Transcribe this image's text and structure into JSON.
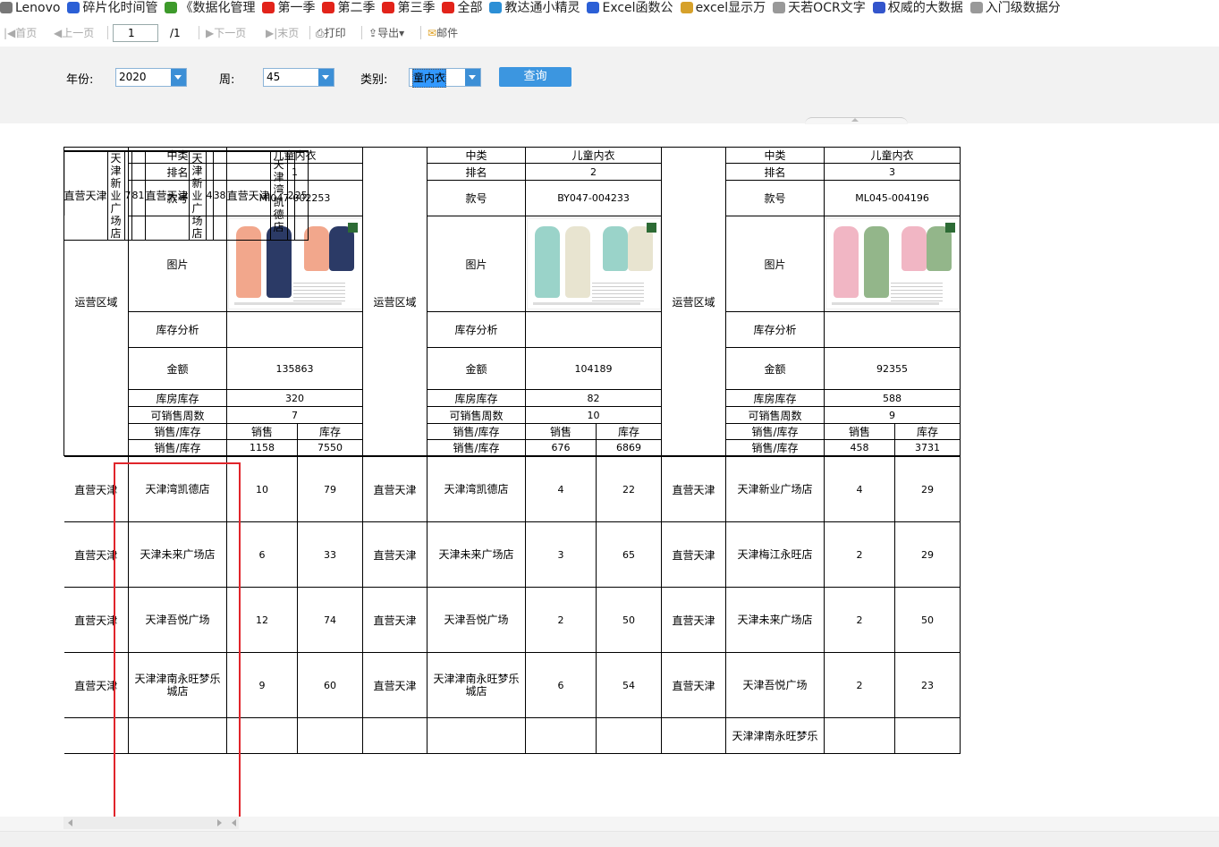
{
  "bookmarks": [
    {
      "label": "Lenovo",
      "icon": "folder-icon",
      "color": "#777777"
    },
    {
      "label": "碎片化时间管",
      "icon": "bookmark-icon",
      "color": "#2b5fd6"
    },
    {
      "label": "《数据化管理",
      "icon": "tree-icon",
      "color": "#3d9a2b"
    },
    {
      "label": "第一季",
      "icon": "weibo-icon",
      "color": "#e2231a"
    },
    {
      "label": "第二季",
      "icon": "weibo-icon",
      "color": "#e2231a"
    },
    {
      "label": "第三季",
      "icon": "weibo-icon",
      "color": "#e2231a"
    },
    {
      "label": "全部",
      "icon": "weibo-icon",
      "color": "#e2231a"
    },
    {
      "label": "教达通小精灵",
      "icon": "edit-icon",
      "color": "#2b8fd6"
    },
    {
      "label": "Excel函数公",
      "icon": "paw-icon",
      "color": "#2b5fd6"
    },
    {
      "label": "excel显示万",
      "icon": "colorful-icon",
      "color": "#d6a12b"
    },
    {
      "label": "天若OCR文字",
      "icon": "page-icon",
      "color": "#999999"
    },
    {
      "label": "权威的大数据",
      "icon": "link-icon",
      "color": "#3355cc"
    },
    {
      "label": "入门级数据分",
      "icon": "page-icon",
      "color": "#999999"
    }
  ],
  "toolbar": {
    "first": "首页",
    "prev": "上一页",
    "page": "1",
    "total": "/1",
    "next": "下一页",
    "last": "末页",
    "print": "打印",
    "export": "导出",
    "mail": "邮件"
  },
  "filters": {
    "year_label": "年份:",
    "year_value": "2020",
    "week_label": "周:",
    "week_value": "45",
    "category_label": "类别:",
    "category_value": "童内衣",
    "query": "查询"
  },
  "report": {
    "side_label": "运营区域",
    "labels": {
      "category": "中类",
      "rank": "排名",
      "style": "款号",
      "image": "图片",
      "stock_analysis": "库存分析",
      "amount": "金额",
      "warehouse": "库房库存",
      "weeks": "可销售周数",
      "sales_stock": "销售/库存",
      "sales": "销售",
      "stock": "库存"
    },
    "products": [
      {
        "category": "儿童内衣",
        "rank": "1",
        "style": "MI047-002253",
        "stock_analysis": "",
        "amount": "135863",
        "warehouse": "320",
        "weeks": "7",
        "total_sales": "1158",
        "total_stock": "7550"
      },
      {
        "category": "儿童内衣",
        "rank": "2",
        "style": "BY047-004233",
        "stock_analysis": "",
        "amount": "104189",
        "warehouse": "82",
        "weeks": "10",
        "total_sales": "676",
        "total_stock": "6869"
      },
      {
        "category": "儿童内衣",
        "rank": "3",
        "style": "ML045-004196",
        "stock_analysis": "",
        "amount": "92355",
        "warehouse": "588",
        "weeks": "9",
        "total_sales": "458",
        "total_stock": "3731"
      }
    ],
    "rows": [
      [
        {
          "region": "直营天津",
          "store": "天津新业广场店",
          "sales": "7",
          "stock": "81"
        },
        {
          "region": "直营天津",
          "store": "天津新业广场店",
          "sales": "4",
          "stock": "38"
        },
        {
          "region": "直营天津",
          "store": "天津湾凯德店",
          "sales": "2",
          "stock": "25"
        }
      ],
      [
        {
          "region": "直营天津",
          "store": "天津湾凯德店",
          "sales": "10",
          "stock": "79"
        },
        {
          "region": "直营天津",
          "store": "天津湾凯德店",
          "sales": "4",
          "stock": "22"
        },
        {
          "region": "直营天津",
          "store": "天津新业广场店",
          "sales": "4",
          "stock": "29"
        }
      ],
      [
        {
          "region": "直营天津",
          "store": "天津未来广场店",
          "sales": "6",
          "stock": "33"
        },
        {
          "region": "直营天津",
          "store": "天津未来广场店",
          "sales": "3",
          "stock": "65"
        },
        {
          "region": "直营天津",
          "store": "天津梅江永旺店",
          "sales": "2",
          "stock": "29"
        }
      ],
      [
        {
          "region": "直营天津",
          "store": "天津吾悦广场",
          "sales": "12",
          "stock": "74"
        },
        {
          "region": "直营天津",
          "store": "天津吾悦广场",
          "sales": "2",
          "stock": "50"
        },
        {
          "region": "直营天津",
          "store": "天津未来广场店",
          "sales": "2",
          "stock": "50"
        }
      ],
      [
        {
          "region": "直营天津",
          "store": "天津津南永旺梦乐城店",
          "sales": "9",
          "stock": "60"
        },
        {
          "region": "直营天津",
          "store": "天津津南永旺梦乐城店",
          "sales": "6",
          "stock": "54"
        },
        {
          "region": "直营天津",
          "store": "天津吾悦广场",
          "sales": "2",
          "stock": "23"
        }
      ],
      [
        {
          "region": "",
          "store": "",
          "sales": "",
          "stock": ""
        },
        {
          "region": "",
          "store": "",
          "sales": "",
          "stock": ""
        },
        {
          "region": "",
          "store": "天津津南永旺梦乐",
          "sales": "",
          "stock": ""
        }
      ]
    ]
  },
  "colors": {
    "accent": "#3c96e0",
    "highlight": "#e0252b",
    "filter_bg": "#f2f2f2"
  }
}
